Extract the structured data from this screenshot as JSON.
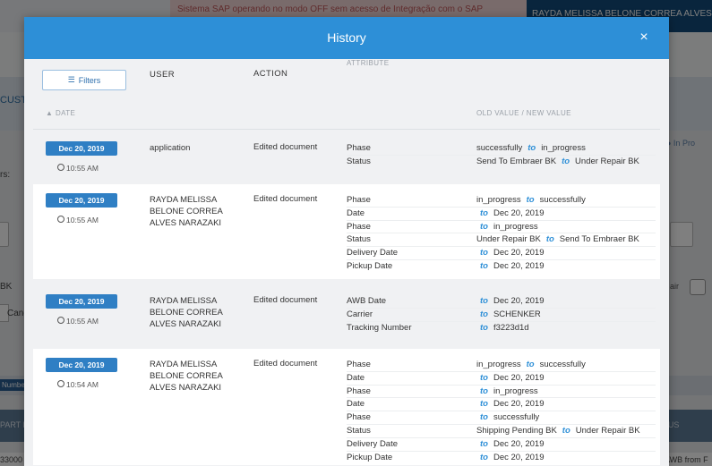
{
  "background": {
    "warning": "Sistema SAP operando no modo OFF sem acesso de Integração com o SAP",
    "user_name": "RAYDA MELISSA BELONE CORREA ALVES NARAZAKI",
    "section_label": "CUST",
    "reason_label": "rs:",
    "bk_label": "BK",
    "cancel_label": "Canc",
    "legend": "ly  ● In Pro",
    "air_label": "air",
    "number_badge": "Number",
    "part_label": "PART N",
    "status_label": "ATUS",
    "code": "33000",
    "awb_from": "AWB from F"
  },
  "modal": {
    "title": "History",
    "close_icon": "×",
    "filters_label": "Filters",
    "columns": {
      "date": "DATE",
      "user": "USER",
      "action": "ACTION",
      "attribute": "ATTRIBUTE",
      "values": "OLD VALUE / NEW VALUE"
    },
    "to_word": "to",
    "entries": [
      {
        "date": "Dec 20, 2019",
        "time": "10:55 AM",
        "user": "application",
        "action": "Edited document",
        "changes": [
          {
            "attribute": "Phase",
            "old": "successfully",
            "new": "in_progress"
          },
          {
            "attribute": "Status",
            "old": "Send To Embraer BK",
            "new": "Under Repair BK"
          }
        ]
      },
      {
        "date": "Dec 20, 2019",
        "time": "10:55 AM",
        "user": "RAYDA MELISSA BELONE CORREA ALVES NARAZAKI",
        "action": "Edited document",
        "changes": [
          {
            "attribute": "Phase",
            "old": "in_progress",
            "new": "successfully"
          },
          {
            "attribute": "Date",
            "old": "",
            "new": "Dec 20, 2019"
          },
          {
            "attribute": "Phase",
            "old": "",
            "new": "in_progress"
          },
          {
            "attribute": "Status",
            "old": "Under Repair BK",
            "new": "Send To Embraer BK"
          },
          {
            "attribute": "Delivery Date",
            "old": "",
            "new": "Dec 20, 2019"
          },
          {
            "attribute": "Pickup Date",
            "old": "",
            "new": "Dec 20, 2019"
          }
        ]
      },
      {
        "date": "Dec 20, 2019",
        "time": "10:55 AM",
        "user": "RAYDA MELISSA BELONE CORREA ALVES NARAZAKI",
        "action": "Edited document",
        "changes": [
          {
            "attribute": "AWB Date",
            "old": "",
            "new": "Dec 20, 2019"
          },
          {
            "attribute": "Carrier",
            "old": "",
            "new": "SCHENKER"
          },
          {
            "attribute": "Tracking Number",
            "old": "",
            "new": "f3223d1d"
          }
        ]
      },
      {
        "date": "Dec 20, 2019",
        "time": "10:54 AM",
        "user": "RAYDA MELISSA BELONE CORREA ALVES NARAZAKI",
        "action": "Edited document",
        "changes": [
          {
            "attribute": "Phase",
            "old": "in_progress",
            "new": "successfully"
          },
          {
            "attribute": "Date",
            "old": "",
            "new": "Dec 20, 2019"
          },
          {
            "attribute": "Phase",
            "old": "",
            "new": "in_progress"
          },
          {
            "attribute": "Date",
            "old": "",
            "new": "Dec 20, 2019"
          },
          {
            "attribute": "Phase",
            "old": "",
            "new": "successfully"
          },
          {
            "attribute": "Status",
            "old": "Shipping Pending BK",
            "new": "Under Repair BK"
          },
          {
            "attribute": "Delivery Date",
            "old": "",
            "new": "Dec 20, 2019"
          },
          {
            "attribute": "Pickup Date",
            "old": "",
            "new": "Dec 20, 2019"
          }
        ]
      }
    ]
  },
  "colors": {
    "header": "#2d8fd7",
    "badge": "#2f7fc4",
    "to_link": "#2d8fd7"
  }
}
